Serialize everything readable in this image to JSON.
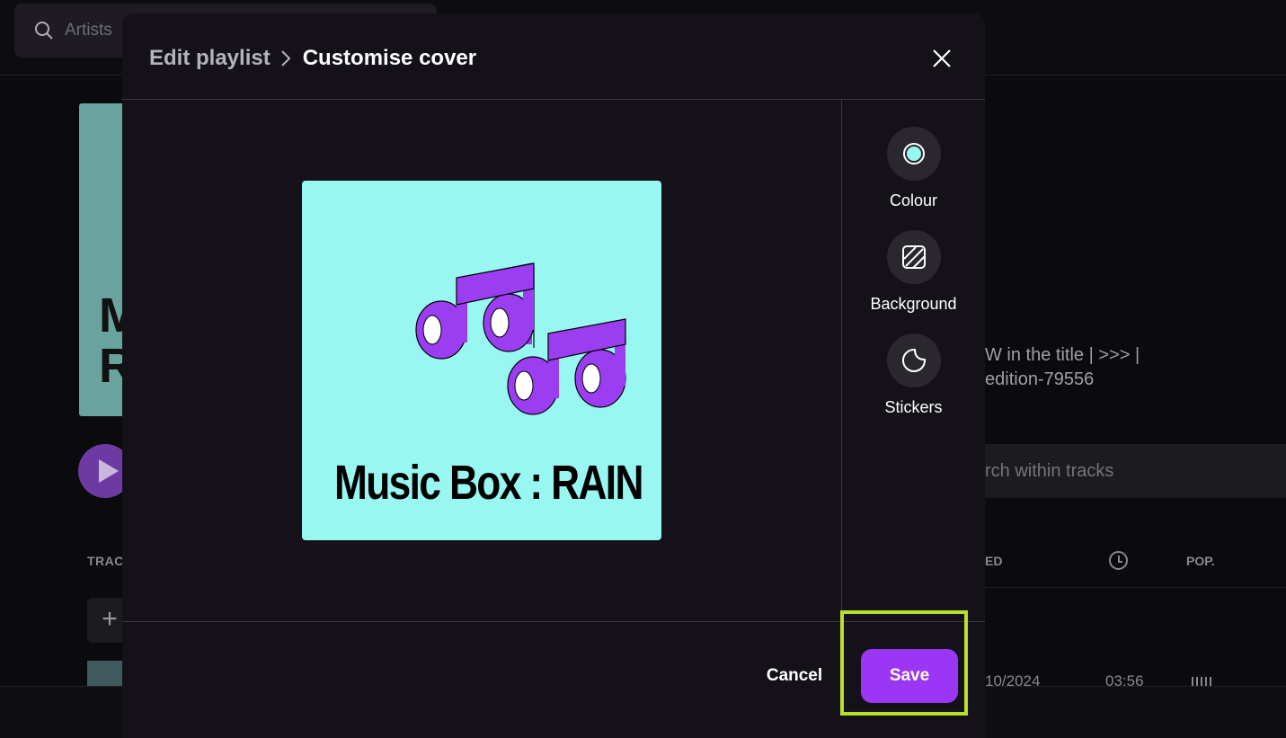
{
  "background": {
    "search_placeholder": "Artists",
    "cover_text": "M\nR",
    "description_line1": "W in the title | >>> |",
    "description_line2": "edition-79556",
    "tracks_search_placeholder": "rch within tracks",
    "col_track": "TRAC",
    "col_added": "ED",
    "col_pop": "POP.",
    "row_date": "10/2024",
    "row_duration": "03:56"
  },
  "modal": {
    "breadcrumb_parent": "Edit playlist",
    "breadcrumb_current": "Customise cover",
    "cover": {
      "title": "Music Box : RAIN",
      "background_color": "#99f7f2",
      "notes_color": "#9b3df0"
    },
    "tools": [
      {
        "label": "Colour",
        "icon": "colour-icon"
      },
      {
        "label": "Background",
        "icon": "background-pattern-icon"
      },
      {
        "label": "Stickers",
        "icon": "sticker-icon"
      }
    ],
    "cancel_label": "Cancel",
    "save_label": "Save"
  },
  "colors": {
    "accent": "#9b36f5",
    "highlight": "#b8e02a"
  }
}
